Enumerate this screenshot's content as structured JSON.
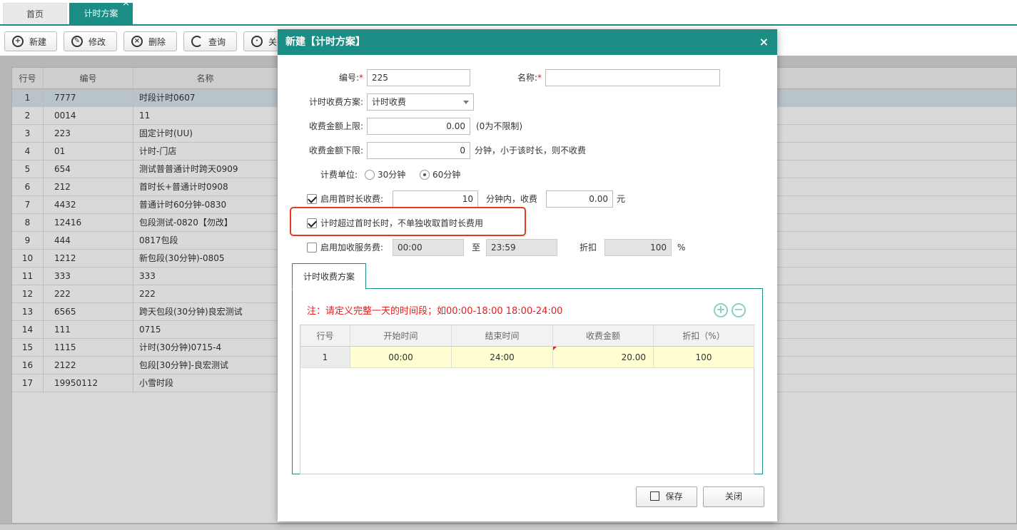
{
  "tabs": {
    "home": "首页",
    "active": "计时方案"
  },
  "toolbar": {
    "new": "新建",
    "edit": "修改",
    "delete": "删除",
    "query": "查询",
    "close": "关"
  },
  "grid": {
    "headers": [
      "行号",
      "编号",
      "名称"
    ],
    "rows": [
      [
        "1",
        "7777",
        "时段计时0607"
      ],
      [
        "2",
        "0014",
        "11"
      ],
      [
        "3",
        "223",
        "固定计时(UU)"
      ],
      [
        "4",
        "01",
        "计时-门店"
      ],
      [
        "5",
        "654",
        "测试普普通计时跨天0909"
      ],
      [
        "6",
        "212",
        "首时长+普通计时0908"
      ],
      [
        "7",
        "4432",
        "普通计时60分钟-0830"
      ],
      [
        "8",
        "12416",
        "包段测试-0820【勿改】"
      ],
      [
        "9",
        "444",
        "0817包段"
      ],
      [
        "10",
        "1212",
        "新包段(30分钟)-0805"
      ],
      [
        "11",
        "333",
        "333"
      ],
      [
        "12",
        "222",
        "222"
      ],
      [
        "13",
        "6565",
        "跨天包段(30分钟)良宏测试"
      ],
      [
        "14",
        "111",
        "0715"
      ],
      [
        "15",
        "1115",
        "计时(30分钟)0715-4"
      ],
      [
        "16",
        "2122",
        "包段[30分钟]-良宏测试"
      ],
      [
        "17",
        "19950112",
        "小雪时段"
      ]
    ]
  },
  "dialog": {
    "title": "新建【计时方案】",
    "close": "×",
    "code_label": "编号:",
    "code_value": "225",
    "name_label": "名称:",
    "name_value": "",
    "scheme_label": "计时收费方案:",
    "scheme_value": "计时收费",
    "max_label": "收费金额上限:",
    "max_value": "0.00",
    "max_hint": "(0为不限制)",
    "min_label": "收费金额下限:",
    "min_value": "0",
    "min_hint": "分钟，小于该时长，则不收费",
    "unit_label": "计费单位:",
    "unit_opt1": "30分钟",
    "unit_opt2": "60分钟",
    "unit_selected": "60分钟",
    "first_label": "启用首时长收费:",
    "first_minutes": "10",
    "first_mid": "分钟内，收费",
    "first_fee": "0.00",
    "first_unit": "元",
    "first_checked": true,
    "exceed_label": "计时超过首时长时，不单独收取首时长费用",
    "exceed_checked": true,
    "service_label": "启用加收服务费:",
    "service_from": "00:00",
    "service_to_label": "至",
    "service_to": "23:59",
    "discount_label": "折扣",
    "discount_value": "100",
    "discount_unit": "%",
    "service_checked": false,
    "inner_tab": "计时收费方案",
    "note": "注：请定义完整一天的时间段；如00:00-18:00 18:00-24:00",
    "plus_icon": "+",
    "minus_icon": "−",
    "table_headers": [
      "行号",
      "开始时间",
      "结束时间",
      "收费金额",
      "折扣（%）"
    ],
    "table_rows": [
      [
        "1",
        "00:00",
        "24:00",
        "20.00",
        "100"
      ]
    ],
    "save": "保存",
    "cancel": "关闭"
  }
}
